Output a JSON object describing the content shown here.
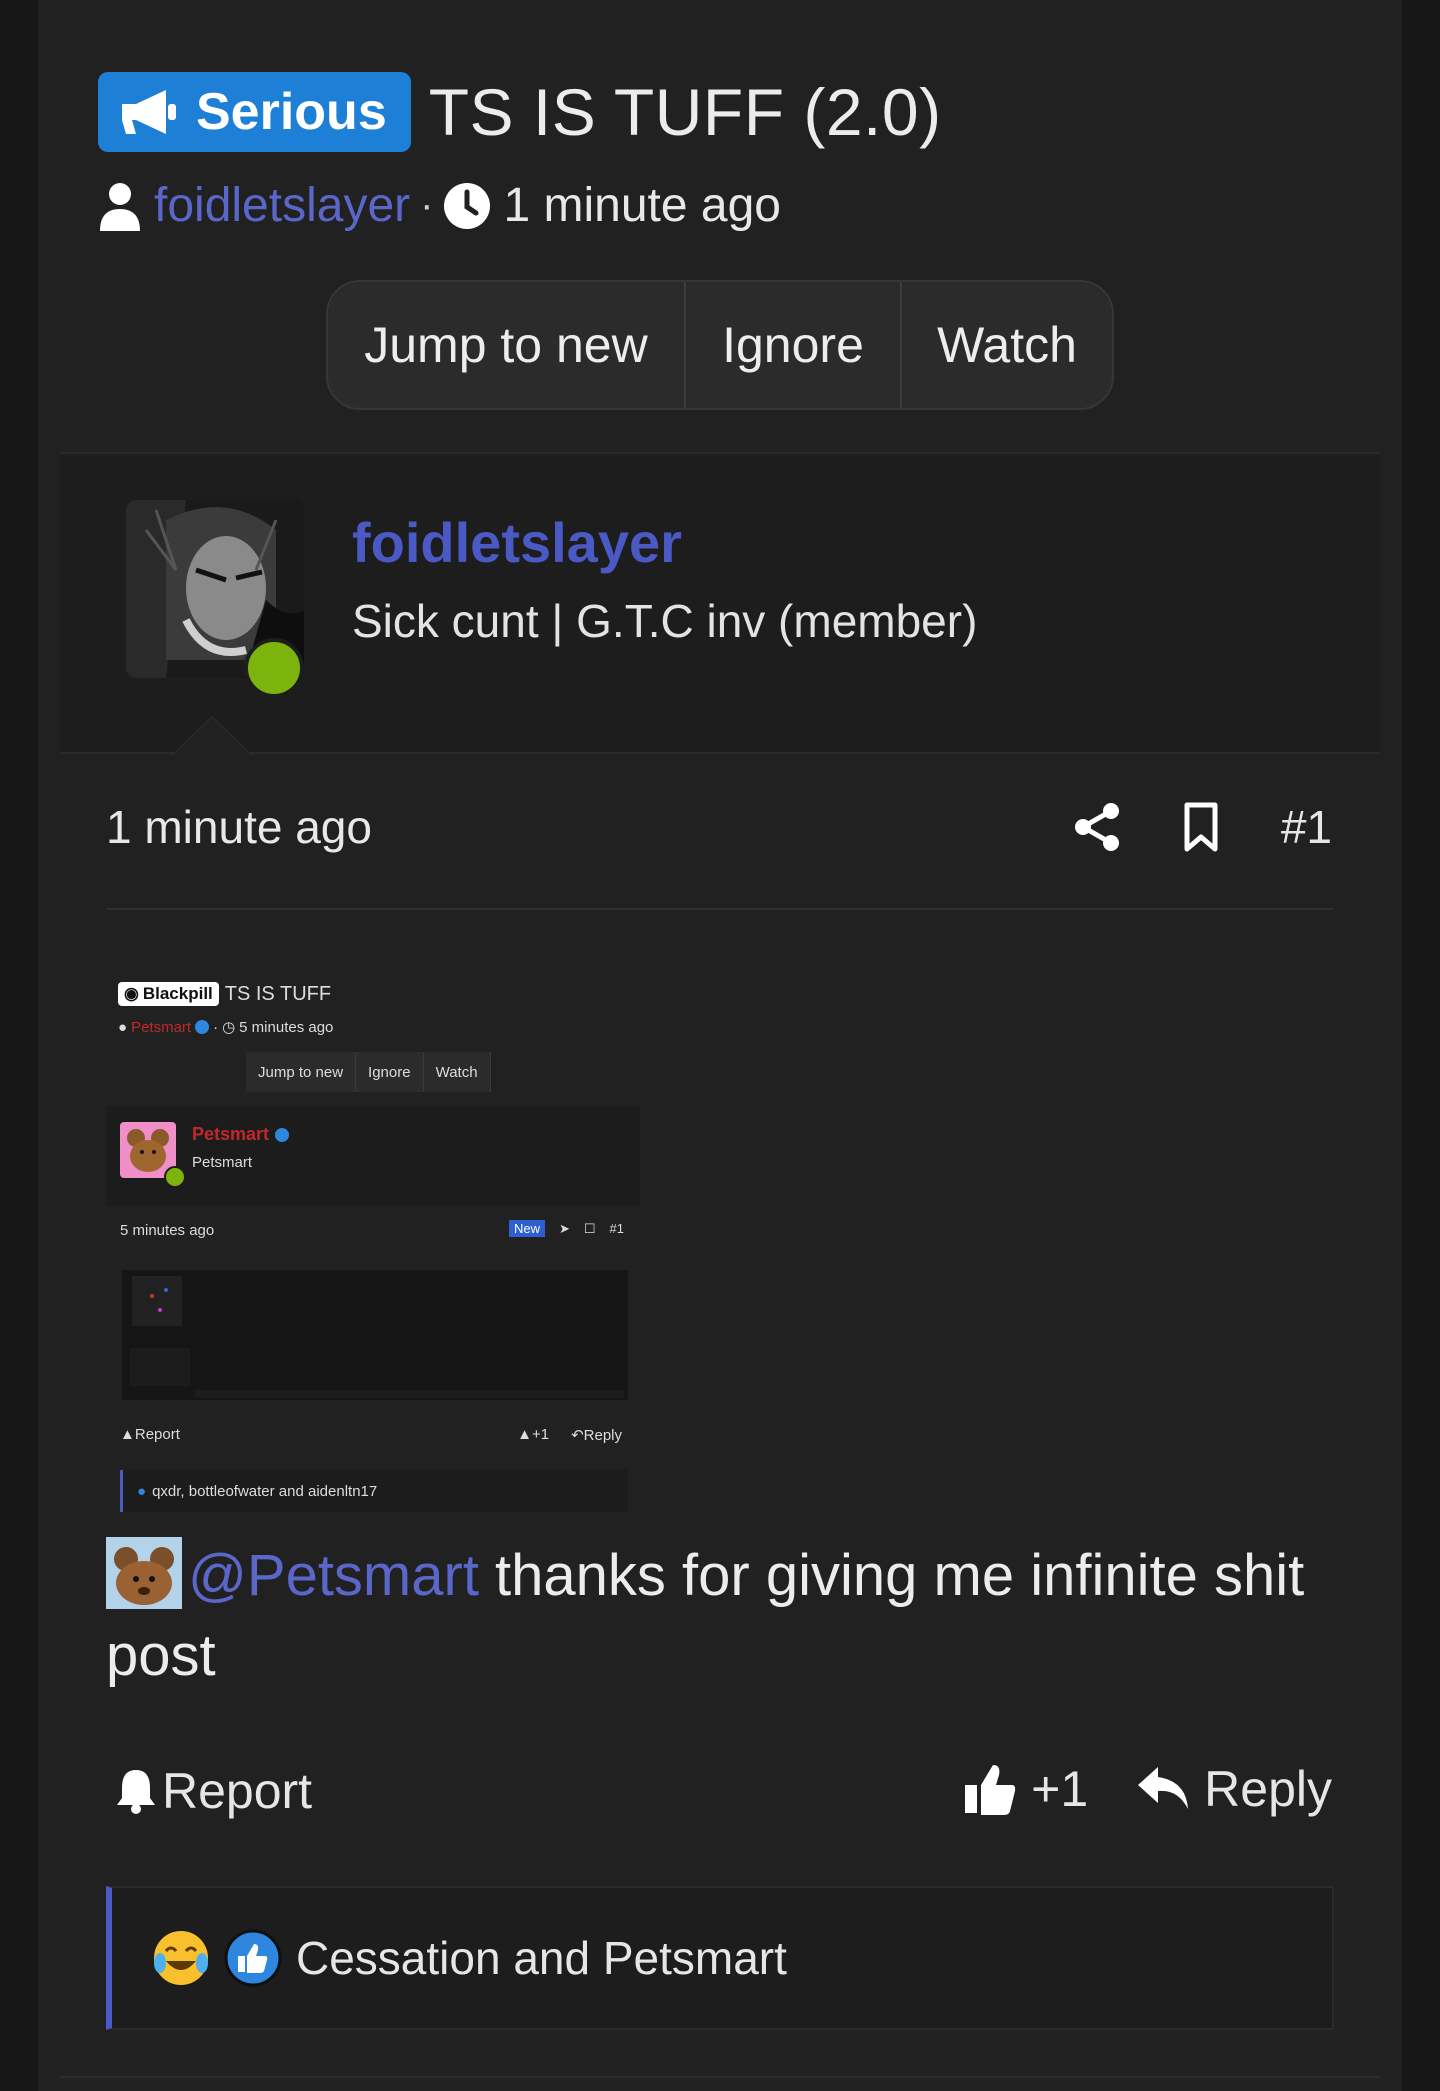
{
  "thread": {
    "prefix": "Serious",
    "title": "TS IS TUFF (2.0)",
    "author": "foidletslayer",
    "separator": "·",
    "time": "1 minute ago"
  },
  "thread_buttons": {
    "jump": "Jump to new",
    "ignore": "Ignore",
    "watch": "Watch"
  },
  "post": {
    "username": "foidletslayer",
    "user_title": "Sick cunt | G.T.C inv (member)",
    "time": "1 minute ago",
    "number": "#1",
    "mention": "@Petsmart",
    "message_text": " thanks for giving me infinite shit post",
    "report": "Report",
    "like_count": "+1",
    "reply": "Reply",
    "reactions_text": "Cessation and Petsmart"
  },
  "embedded": {
    "badge": "Blackpill",
    "title": "TS IS TUFF",
    "author": "Petsmart",
    "separator": "·",
    "time": "5 minutes ago",
    "btn_jump": "Jump to new",
    "btn_ignore": "Ignore",
    "btn_watch": "Watch",
    "username": "Petsmart",
    "user_title": "Petsmart",
    "post_time": "5 minutes ago",
    "new_label": "New",
    "number": "#1",
    "report": "Report",
    "like": "+1",
    "reply": "Reply",
    "reactions": "qxdr, bottleofwater and aidenltn17"
  },
  "colors": {
    "accent": "#4a59c4",
    "badge": "#1e7fd6",
    "online": "#7cb40d",
    "embed_red": "#c0282c"
  }
}
